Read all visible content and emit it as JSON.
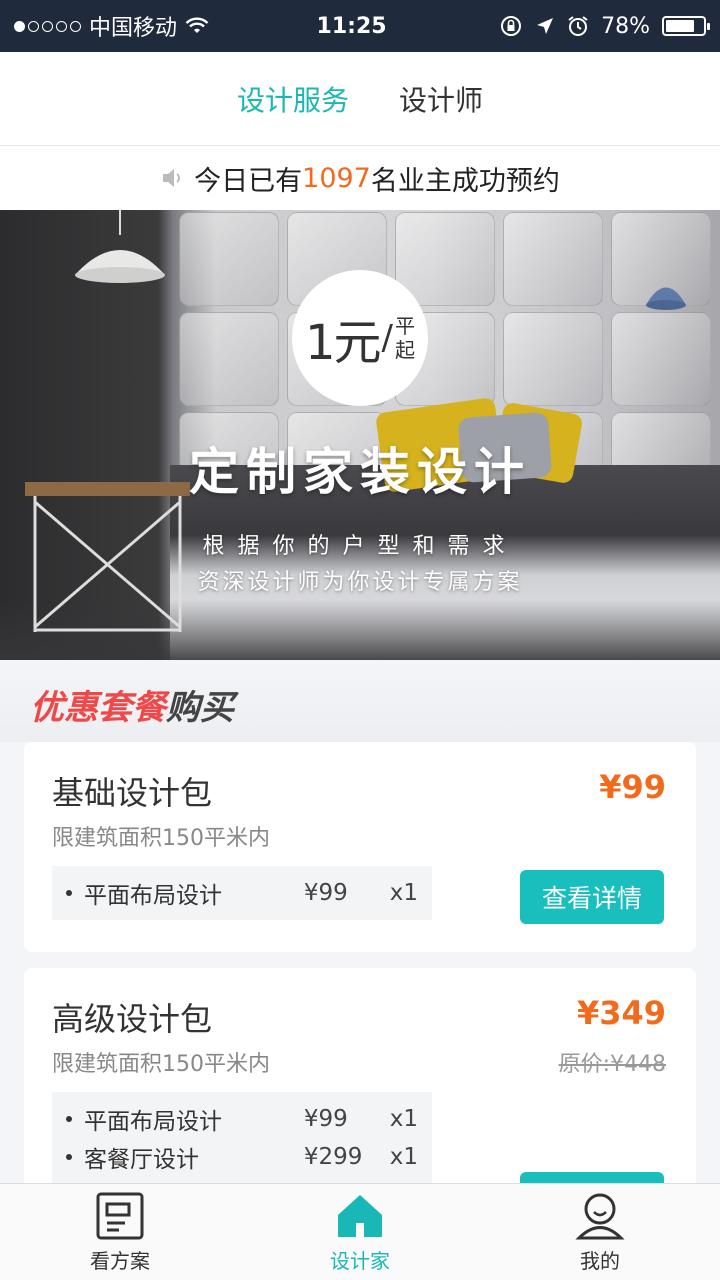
{
  "status_bar": {
    "carrier": "中国移动",
    "time": "11:25",
    "battery": "78%",
    "battery_level": 0.78
  },
  "top_tabs": [
    {
      "label": "设计服务",
      "active": true
    },
    {
      "label": "设计师",
      "active": false
    }
  ],
  "notice": {
    "prefix": "今日已有",
    "count": "1097",
    "suffix": "名业主成功预约"
  },
  "banner": {
    "price_big": "1元",
    "price_slash": "/",
    "price_unit_top": "平",
    "price_unit_bottom": "起",
    "title": "定制家装设计",
    "sub1": "根据你的户型和需求",
    "sub2": "资深设计师为你设计专属方案"
  },
  "section": {
    "title_red": "优惠套餐",
    "title_dark": "购买"
  },
  "packages": [
    {
      "name": "基础设计包",
      "price": "¥99",
      "limit": "限建筑面积150平米内",
      "items": [
        {
          "name": "平面布局设计",
          "price": "¥99",
          "qty": "x1"
        }
      ],
      "button": "查看详情"
    },
    {
      "name": "高级设计包",
      "price": "¥349",
      "original_price": "原价:¥448",
      "limit": "限建筑面积150平米内",
      "items": [
        {
          "name": "平面布局设计",
          "price": "¥99",
          "qty": "x1"
        },
        {
          "name": "客餐厅设计",
          "price": "¥299",
          "qty": "x1"
        }
      ]
    }
  ],
  "bottom_nav": [
    {
      "label": "看方案",
      "icon": "document-icon",
      "active": false
    },
    {
      "label": "设计家",
      "icon": "house-icon",
      "active": true
    },
    {
      "label": "我的",
      "icon": "user-icon",
      "active": false
    }
  ],
  "colors": {
    "accent": "#19b7b5",
    "price": "#f26a1b",
    "promo_red": "#f04848",
    "status_bar": "#1f2a3c"
  }
}
